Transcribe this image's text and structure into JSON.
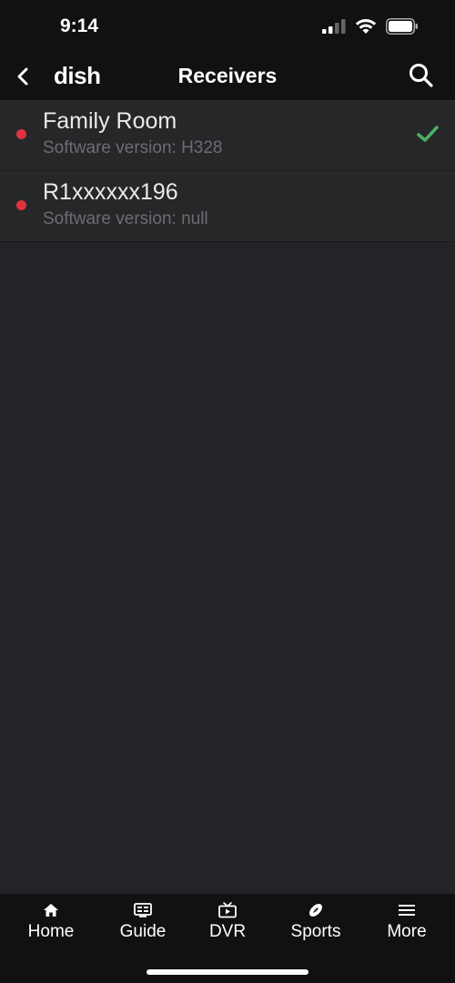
{
  "status_bar": {
    "time": "9:14",
    "icons": [
      "signal-icon",
      "wifi-icon",
      "battery-icon"
    ]
  },
  "nav": {
    "logo_text": "dish",
    "title": "Receivers",
    "back_icon": "chevron-left-icon",
    "search_icon": "search-icon"
  },
  "receivers": [
    {
      "name": "Family Room",
      "version": "Software version: H328",
      "status_color": "#e0323c",
      "selected": true
    },
    {
      "name": "R1xxxxxx196",
      "version": "Software version: null",
      "status_color": "#e0323c",
      "selected": false
    }
  ],
  "tabs": [
    {
      "label": "Home",
      "icon": "home-icon"
    },
    {
      "label": "Guide",
      "icon": "guide-icon"
    },
    {
      "label": "DVR",
      "icon": "dvr-icon"
    },
    {
      "label": "Sports",
      "icon": "football-icon"
    },
    {
      "label": "More",
      "icon": "menu-icon"
    }
  ],
  "colors": {
    "background": "#232427",
    "bar": "#111111",
    "status_dot": "#e0323c",
    "check": "#4caf62",
    "secondary_text": "#6c6d70"
  }
}
